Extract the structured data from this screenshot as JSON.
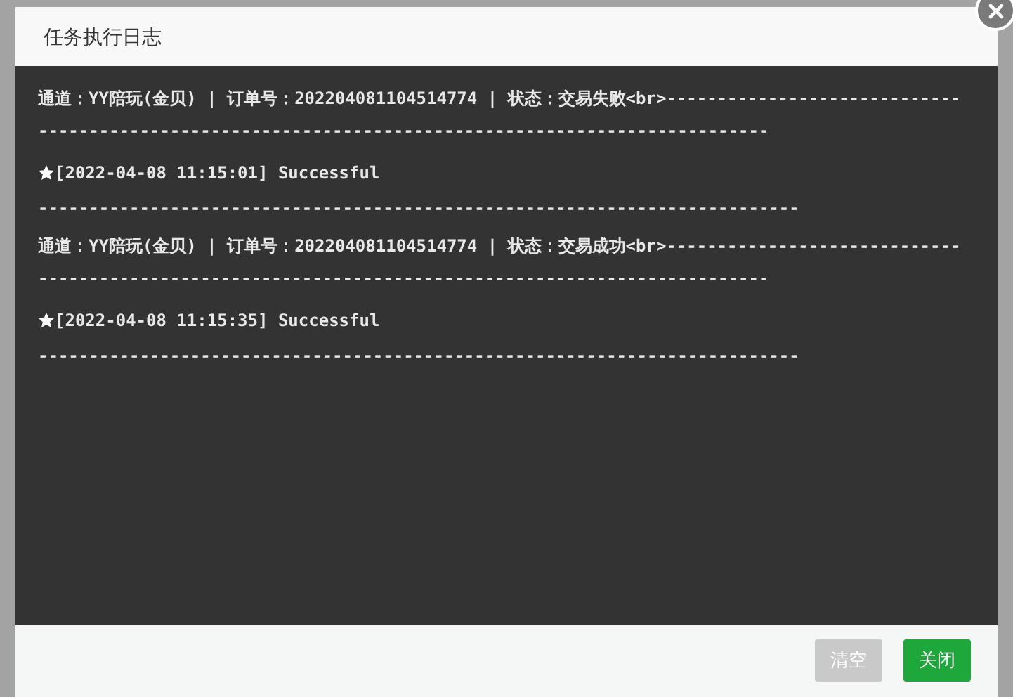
{
  "dialog": {
    "title": "任务执行日志",
    "log": [
      {
        "kind": "record",
        "text": "通道：YY陪玩(金贝) | 订单号：202204081104514774 | 状态：交易失败<br>-----------------------------------------------------------------------------------------------------"
      },
      {
        "kind": "result",
        "text": "[2022-04-08 11:15:01] Successful"
      },
      {
        "kind": "rule",
        "text": "---------------------------------------------------------------------------"
      },
      {
        "kind": "record",
        "text": "通道：YY陪玩(金贝) | 订单号：202204081104514774 | 状态：交易成功<br>-----------------------------------------------------------------------------------------------------"
      },
      {
        "kind": "result",
        "text": "[2022-04-08 11:15:35] Successful"
      },
      {
        "kind": "rule",
        "text": "---------------------------------------------------------------------------"
      }
    ],
    "buttons": [
      {
        "label": "清空",
        "kind": "secondary"
      },
      {
        "label": "关闭",
        "kind": "primary"
      }
    ]
  }
}
